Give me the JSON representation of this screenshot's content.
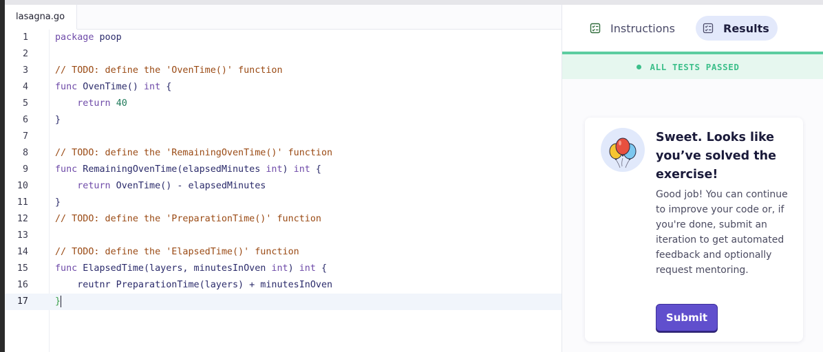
{
  "editor": {
    "tab_label": "lasagna.go",
    "active_line": 17,
    "lines": [
      {
        "num": "1",
        "text": "package poop"
      },
      {
        "num": "2",
        "text": ""
      },
      {
        "num": "3",
        "text": "// TODO: define the 'OvenTime()' function"
      },
      {
        "num": "4",
        "text": "func OvenTime() int {"
      },
      {
        "num": "5",
        "text": "    return 40"
      },
      {
        "num": "6",
        "text": "}"
      },
      {
        "num": "7",
        "text": ""
      },
      {
        "num": "8",
        "text": "// TODO: define the 'RemainingOvenTime()' function"
      },
      {
        "num": "9",
        "text": "func RemainingOvenTime(elapsedMinutes int) int {"
      },
      {
        "num": "10",
        "text": "    return OvenTime() - elapsedMinutes"
      },
      {
        "num": "11",
        "text": "}"
      },
      {
        "num": "12",
        "text": "// TODO: define the 'PreparationTime()' function"
      },
      {
        "num": "13",
        "text": ""
      },
      {
        "num": "14",
        "text": "// TODO: define the 'ElapsedTime()' function"
      },
      {
        "num": "15",
        "text": "func ElapsedTime(layers, minutesInOven int) int {"
      },
      {
        "num": "16",
        "text": "    reutnr PreparationTime(layers) + minutesInOven"
      },
      {
        "num": "17",
        "text": "}"
      }
    ]
  },
  "panel": {
    "tabs": {
      "instructions": "Instructions",
      "results": "Results"
    },
    "status": "ALL TESTS PASSED",
    "card": {
      "title": "Sweet. Looks like you’ve solved the exercise!",
      "body": "Good job! You can continue to improve your code or, if you're done, submit an iteration to get automated feedback and optionally request mentoring.",
      "submit_label": "Submit",
      "icon": "balloons-icon"
    }
  },
  "colors": {
    "accent": "#604fcd",
    "success": "#3cbf8a",
    "tab_active_bg": "#e3e9fb"
  }
}
